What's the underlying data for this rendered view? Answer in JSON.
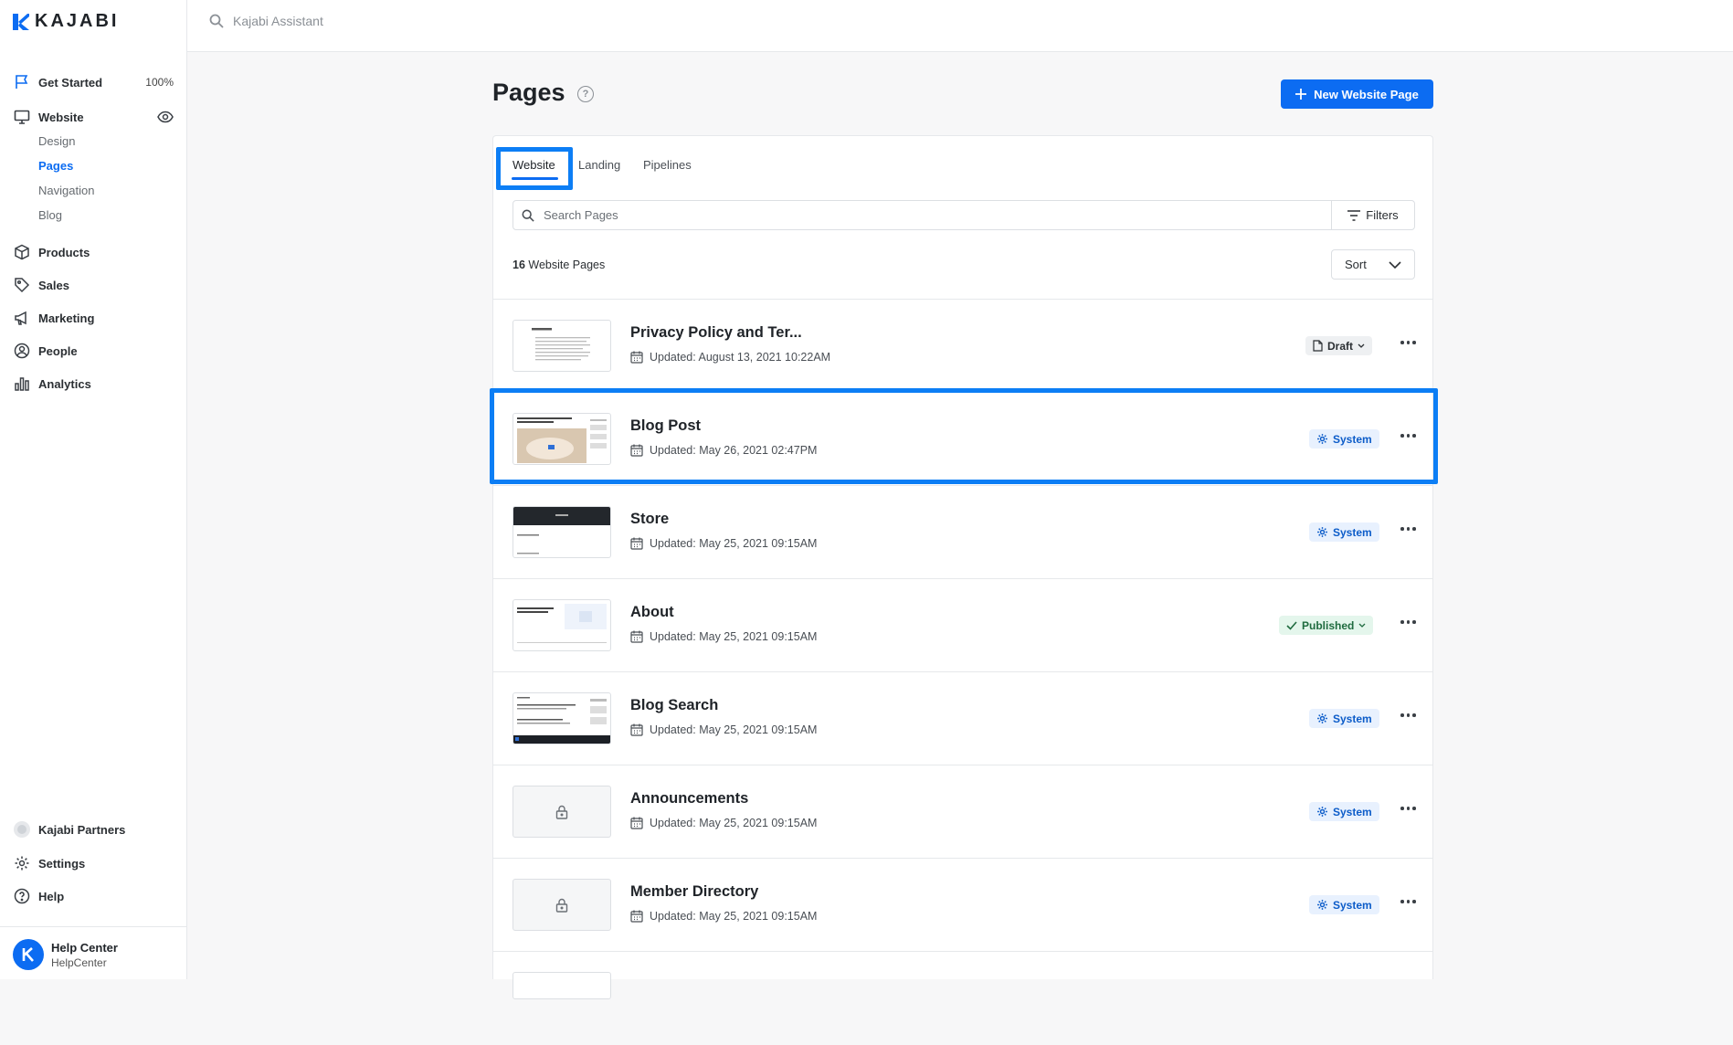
{
  "brand": {
    "name": "KAJABI",
    "accent": "#0c6cf2"
  },
  "sidebar": {
    "get_started": {
      "label": "Get Started",
      "progress": "100%"
    },
    "website": {
      "label": "Website",
      "sub_items": [
        {
          "label": "Design",
          "active": false
        },
        {
          "label": "Pages",
          "active": true
        },
        {
          "label": "Navigation",
          "active": false
        },
        {
          "label": "Blog",
          "active": false
        }
      ]
    },
    "items": [
      {
        "label": "Products",
        "icon": "box-icon"
      },
      {
        "label": "Sales",
        "icon": "tag-icon"
      },
      {
        "label": "Marketing",
        "icon": "megaphone-icon"
      },
      {
        "label": "People",
        "icon": "person-icon"
      },
      {
        "label": "Analytics",
        "icon": "bar-chart-icon"
      }
    ],
    "bottom": [
      {
        "label": "Kajabi Partners",
        "icon": "partners-icon"
      },
      {
        "label": "Settings",
        "icon": "gear-icon"
      },
      {
        "label": "Help",
        "icon": "help-icon"
      }
    ],
    "help_center": {
      "title": "Help Center",
      "subtitle": "HelpCenter"
    }
  },
  "topbar": {
    "search_placeholder": "Kajabi Assistant"
  },
  "main": {
    "title": "Pages",
    "new_button": "New Website Page",
    "tabs": [
      {
        "label": "Website",
        "active": true
      },
      {
        "label": "Landing",
        "active": false
      },
      {
        "label": "Pipelines",
        "active": false
      }
    ],
    "search_placeholder": "Search Pages",
    "filters_label": "Filters",
    "count_number": "16",
    "count_label": "Website Pages",
    "sort_label": "Sort",
    "pages": [
      {
        "title": "Privacy Policy and Ter...",
        "updated": "Updated: August 13, 2021 10:22AM",
        "status": "Draft",
        "status_type": "draft",
        "thumb": "doc"
      },
      {
        "title": "Blog Post",
        "updated": "Updated: May 26, 2021 02:47PM",
        "status": "System",
        "status_type": "system",
        "thumb": "blog"
      },
      {
        "title": "Store",
        "updated": "Updated: May 25, 2021 09:15AM",
        "status": "System",
        "status_type": "system",
        "thumb": "store"
      },
      {
        "title": "About",
        "updated": "Updated: May 25, 2021 09:15AM",
        "status": "Published",
        "status_type": "published",
        "thumb": "about"
      },
      {
        "title": "Blog Search",
        "updated": "Updated: May 25, 2021 09:15AM",
        "status": "System",
        "status_type": "system",
        "thumb": "blogsearch"
      },
      {
        "title": "Announcements",
        "updated": "Updated: May 25, 2021 09:15AM",
        "status": "System",
        "status_type": "system",
        "thumb": "locked"
      },
      {
        "title": "Member Directory",
        "updated": "Updated: May 25, 2021 09:15AM",
        "status": "System",
        "status_type": "system",
        "thumb": "locked"
      }
    ]
  }
}
